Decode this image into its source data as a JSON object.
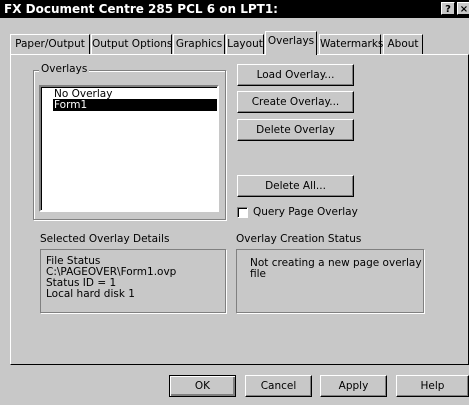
{
  "window": {
    "title": "FX Document Centre 285 PCL 6 on LPT1:"
  },
  "titlebar_buttons": {
    "help": "?",
    "close": "×"
  },
  "tabs": [
    {
      "label": "Paper/Output",
      "active": false
    },
    {
      "label": "Output Options",
      "active": false
    },
    {
      "label": "Graphics",
      "active": false
    },
    {
      "label": "Layout",
      "active": false
    },
    {
      "label": "Overlays",
      "active": true
    },
    {
      "label": "Watermarks",
      "active": false
    },
    {
      "label": "About",
      "active": false
    }
  ],
  "overlays_group": {
    "label": "Overlays",
    "items": [
      {
        "label": "No Overlay",
        "selected": false
      },
      {
        "label": "Form1",
        "selected": true
      }
    ]
  },
  "buttons": {
    "load_overlay": "Load Overlay...",
    "create_overlay": "Create Overlay...",
    "delete_overlay": "Delete Overlay",
    "delete_all": "Delete All..."
  },
  "query_page_overlay": {
    "label": "Query Page Overlay",
    "checked": false
  },
  "selected_details": {
    "label": "Selected Overlay Details",
    "text": "File Status\nC:\\PAGEOVER\\Form1.ovp\nStatus ID = 1\nLocal hard disk 1"
  },
  "creation_status": {
    "label": "Overlay Creation Status",
    "text": "Not creating a new page overlay\nfile"
  },
  "footer": {
    "ok": "OK",
    "cancel": "Cancel",
    "apply": "Apply",
    "help": "Help"
  }
}
